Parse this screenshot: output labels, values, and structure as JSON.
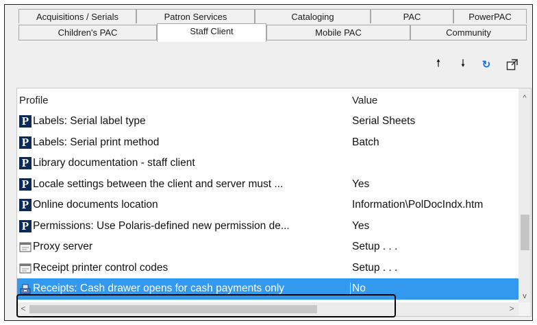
{
  "tabs_row1": [
    "Acquisitions / Serials",
    "Patron Services",
    "Cataloging",
    "PAC",
    "PowerPAC"
  ],
  "tabs_row2": [
    "Children's PAC",
    "Staff Client",
    "Mobile PAC",
    "Community"
  ],
  "active_tab": "Staff Client",
  "toolbar": {
    "move_up_icon": "arrow-up-icon",
    "move_down_icon": "arrow-down-icon",
    "refresh_icon": "refresh-icon",
    "export_icon": "export-icon",
    "up_glyph": "🠕",
    "down_glyph": "🠗",
    "refresh_glyph": "↻",
    "export_glyph": "⧉"
  },
  "grid": {
    "columns": [
      "Profile",
      "Value"
    ],
    "rows": [
      {
        "icon": "P",
        "profile": "Labels: Serial label type",
        "value": "Serial Sheets"
      },
      {
        "icon": "P",
        "profile": "Labels: Serial print method",
        "value": "Batch"
      },
      {
        "icon": "P",
        "profile": "Library documentation - staff client",
        "value": ""
      },
      {
        "icon": "P",
        "profile": "Locale settings between the client and server must ...",
        "value": "Yes"
      },
      {
        "icon": "P",
        "profile": "Online documents location",
        "value": "Information\\PolDocIndx.htm"
      },
      {
        "icon": "P",
        "profile": "Permissions: Use Polaris-defined new permission de...",
        "value": "Yes"
      },
      {
        "icon": "setup",
        "profile": "Proxy server",
        "value": "Setup . . ."
      },
      {
        "icon": "setup",
        "profile": "Receipt printer control codes",
        "value": "Setup . . ."
      },
      {
        "icon": "cash",
        "profile": "Receipts: Cash drawer opens for cash payments only",
        "value": "No",
        "selected": true
      }
    ]
  },
  "scroll": {
    "up": "^",
    "down": "v",
    "left": "<",
    "right": ">"
  },
  "colors": {
    "selection": "#3399ee",
    "badge": "#0d2a56"
  }
}
